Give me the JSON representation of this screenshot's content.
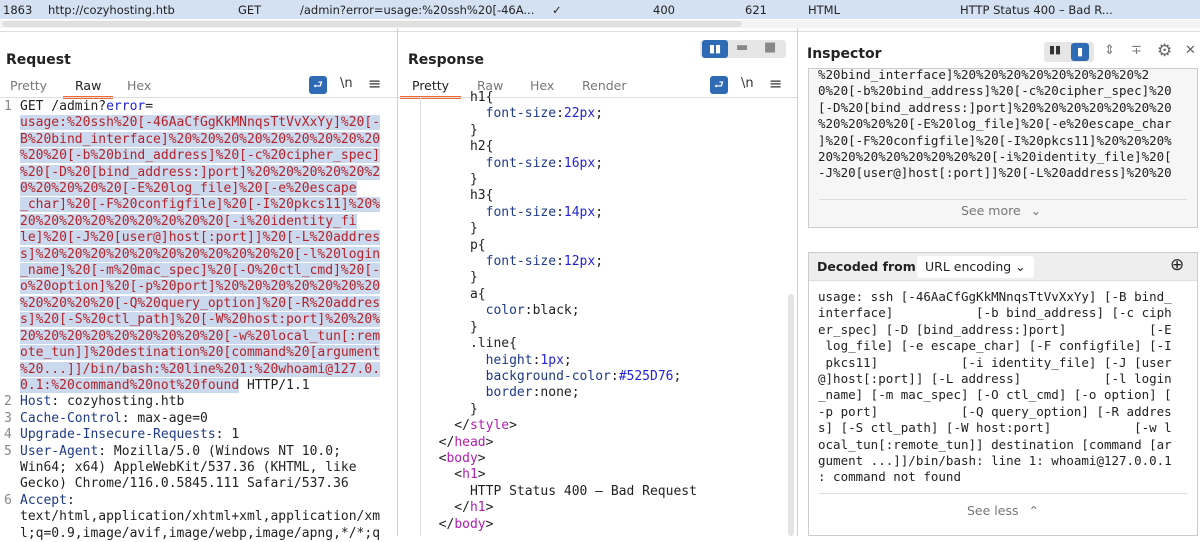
{
  "history_row": {
    "id": "1863",
    "host": "http://cozyhosting.htb",
    "method": "GET",
    "url": "/admin?error=usage:%20ssh%20[-46A...",
    "edited": "✓",
    "status": "400",
    "length": "621",
    "mime": "HTML",
    "title": "HTTP Status 400 – Bad R..."
  },
  "request": {
    "title": "Request",
    "tabs": [
      "Pretty",
      "Raw",
      "Hex"
    ],
    "active_tab": "Raw",
    "lines": [
      {
        "n": "1",
        "s": [
          {
            "t": "GET /admin?"
          },
          {
            "t": "error",
            "c": "bl"
          },
          {
            "t": "="
          }
        ]
      },
      {
        "n": "",
        "s": [
          {
            "t": "usage:%20ssh%20[-46AaCfGgKkMNnqsTtVvXxYy]%20[-",
            "c": "hl"
          }
        ]
      },
      {
        "n": "",
        "s": [
          {
            "t": "B%20bind_interface]%20%20%20%20%20%20%20%20%20",
            "c": "hl"
          }
        ]
      },
      {
        "n": "",
        "s": [
          {
            "t": "%20%20[-b%20bind_address]%20[-c%20cipher_spec]",
            "c": "hl"
          }
        ]
      },
      {
        "n": "",
        "s": [
          {
            "t": "%20[-D%20[bind_address:]port]%20%20%20%20%20%2",
            "c": "hl"
          }
        ]
      },
      {
        "n": "",
        "s": [
          {
            "t": "0%20%20%20%20[-E%20log_file]%20[-e%20escape",
            "c": "hl"
          }
        ]
      },
      {
        "n": "",
        "s": [
          {
            "t": "_char]%20[-F%20configfile]%20[-I%20pkcs11]%20%",
            "c": "hl"
          }
        ]
      },
      {
        "n": "",
        "s": [
          {
            "t": "20%20%20%20%20%20%20%20%20[-i%20identity_fi",
            "c": "hl"
          }
        ]
      },
      {
        "n": "",
        "s": [
          {
            "t": "le]%20[-J%20[user@]host[:port]]%20[-L%20addres",
            "c": "hl"
          }
        ]
      },
      {
        "n": "",
        "s": [
          {
            "t": "s]%20%20%20%20%20%20%20%20%20%20%20[-l%20login",
            "c": "hl"
          }
        ]
      },
      {
        "n": "",
        "s": [
          {
            "t": "_name]%20[-m%20mac_spec]%20[-O%20ctl_cmd]%20[-",
            "c": "hl"
          }
        ]
      },
      {
        "n": "",
        "s": [
          {
            "t": "o%20option]%20[-p%20port]%20%20%20%20%20%20%20",
            "c": "hl"
          }
        ]
      },
      {
        "n": "",
        "s": [
          {
            "t": "%20%20%20%20[-Q%20query_option]%20[-R%20addres",
            "c": "hl"
          }
        ]
      },
      {
        "n": "",
        "s": [
          {
            "t": "s]%20[-S%20ctl_path]%20[-W%20host:port]%20%20%",
            "c": "hl"
          }
        ]
      },
      {
        "n": "",
        "s": [
          {
            "t": "20%20%20%20%20%20%20%20%20[-w%20local_tun[:rem",
            "c": "hl"
          }
        ]
      },
      {
        "n": "",
        "s": [
          {
            "t": "ote_tun]]%20destination%20[command%20[argument",
            "c": "hl"
          }
        ]
      },
      {
        "n": "",
        "s": [
          {
            "t": "%20...]]/bin/bash:%20line%201:%20whoami@127.0.",
            "c": "hl"
          }
        ]
      },
      {
        "n": "",
        "s": [
          {
            "t": "0.1:%20command%20not%20found",
            "c": "hl"
          },
          {
            "t": " HTTP/1.1"
          }
        ]
      },
      {
        "n": "2",
        "s": [
          {
            "t": "Host",
            "c": "hn"
          },
          {
            "t": ": cozyhosting.htb"
          }
        ]
      },
      {
        "n": "3",
        "s": [
          {
            "t": "Cache-Control",
            "c": "hn"
          },
          {
            "t": ": max-age=0"
          }
        ]
      },
      {
        "n": "4",
        "s": [
          {
            "t": "Upgrade-Insecure-Requests",
            "c": "hn"
          },
          {
            "t": ": 1"
          }
        ]
      },
      {
        "n": "5",
        "s": [
          {
            "t": "User-Agent",
            "c": "hn"
          },
          {
            "t": ": Mozilla/5.0 (Windows NT 10.0;"
          }
        ]
      },
      {
        "n": "",
        "s": [
          {
            "t": "Win64; x64) AppleWebKit/537.36 (KHTML, like"
          }
        ]
      },
      {
        "n": "",
        "s": [
          {
            "t": "Gecko) Chrome/116.0.5845.111 Safari/537.36"
          }
        ]
      },
      {
        "n": "6",
        "s": [
          {
            "t": "Accept",
            "c": "hn"
          },
          {
            "t": ":"
          }
        ]
      },
      {
        "n": "",
        "s": [
          {
            "t": "text/html,application/xhtml+xml,application/xm"
          }
        ]
      },
      {
        "n": "",
        "s": [
          {
            "t": "l;q=0.9,image/avif,image/webp,image/apng,*/*;q"
          }
        ]
      }
    ]
  },
  "response": {
    "title": "Response",
    "tabs": [
      "Pretty",
      "Raw",
      "Hex",
      "Render"
    ],
    "active_tab": "Pretty",
    "lines": [
      {
        "s": [
          {
            "t": "      h1{"
          }
        ]
      },
      {
        "s": [
          {
            "t": "        "
          },
          {
            "t": "font-size",
            "c": "hn"
          },
          {
            "t": ":"
          },
          {
            "t": "22px",
            "c": "bl"
          },
          {
            "t": ";"
          }
        ]
      },
      {
        "s": [
          {
            "t": "      }"
          }
        ]
      },
      {
        "s": [
          {
            "t": "      h2{"
          }
        ]
      },
      {
        "s": [
          {
            "t": "        "
          },
          {
            "t": "font-size",
            "c": "hn"
          },
          {
            "t": ":"
          },
          {
            "t": "16px",
            "c": "bl"
          },
          {
            "t": ";"
          }
        ]
      },
      {
        "s": [
          {
            "t": "      }"
          }
        ]
      },
      {
        "s": [
          {
            "t": "      h3{"
          }
        ]
      },
      {
        "s": [
          {
            "t": "        "
          },
          {
            "t": "font-size",
            "c": "hn"
          },
          {
            "t": ":"
          },
          {
            "t": "14px",
            "c": "bl"
          },
          {
            "t": ";"
          }
        ]
      },
      {
        "s": [
          {
            "t": "      }"
          }
        ]
      },
      {
        "s": [
          {
            "t": "      p{"
          }
        ]
      },
      {
        "s": [
          {
            "t": "        "
          },
          {
            "t": "font-size",
            "c": "hn"
          },
          {
            "t": ":"
          },
          {
            "t": "12px",
            "c": "bl"
          },
          {
            "t": ";"
          }
        ]
      },
      {
        "s": [
          {
            "t": "      }"
          }
        ]
      },
      {
        "s": [
          {
            "t": "      a{"
          }
        ]
      },
      {
        "s": [
          {
            "t": "        "
          },
          {
            "t": "color",
            "c": "hn"
          },
          {
            "t": ":black;"
          }
        ]
      },
      {
        "s": [
          {
            "t": "      }"
          }
        ]
      },
      {
        "s": [
          {
            "t": "      .line{"
          }
        ]
      },
      {
        "s": [
          {
            "t": "        "
          },
          {
            "t": "height",
            "c": "hn"
          },
          {
            "t": ":"
          },
          {
            "t": "1px",
            "c": "bl"
          },
          {
            "t": ";"
          }
        ]
      },
      {
        "s": [
          {
            "t": "        "
          },
          {
            "t": "background-color",
            "c": "hn"
          },
          {
            "t": ":"
          },
          {
            "t": "#525D76",
            "c": "bl"
          },
          {
            "t": ";"
          }
        ]
      },
      {
        "s": [
          {
            "t": "        "
          },
          {
            "t": "border",
            "c": "hn"
          },
          {
            "t": ":none;"
          }
        ]
      },
      {
        "s": [
          {
            "t": "      }"
          }
        ]
      },
      {
        "s": [
          {
            "t": "    </"
          },
          {
            "t": "style",
            "c": "tg"
          },
          {
            "t": ">"
          }
        ]
      },
      {
        "s": [
          {
            "t": "  </"
          },
          {
            "t": "head",
            "c": "tg"
          },
          {
            "t": ">"
          }
        ]
      },
      {
        "s": [
          {
            "t": "  <"
          },
          {
            "t": "body",
            "c": "tg"
          },
          {
            "t": ">"
          }
        ]
      },
      {
        "s": [
          {
            "t": "    <"
          },
          {
            "t": "h1",
            "c": "tg"
          },
          {
            "t": ">"
          }
        ]
      },
      {
        "s": [
          {
            "t": "      HTTP Status 400 – Bad Request"
          }
        ]
      },
      {
        "s": [
          {
            "t": "    </"
          },
          {
            "t": "h1",
            "c": "tg"
          },
          {
            "t": ">"
          }
        ]
      },
      {
        "s": [
          {
            "t": "  </"
          },
          {
            "t": "body",
            "c": "tg"
          },
          {
            "t": ">"
          }
        ]
      }
    ]
  },
  "inspector": {
    "title": "Inspector",
    "selected_text": "%20bind_interface]%20%20%20%20%20%20%20%20%2\n0%20[-b%20bind_address]%20[-c%20cipher_spec]%20\n[-D%20[bind_address:]port]%20%20%20%20%20%20%20\n%20%20%20%20[-E%20log_file]%20[-e%20escape_char\n]%20[-F%20configfile]%20[-I%20pkcs11]%20%20%20%\n20%20%20%20%20%20%20%20[-i%20identity_file]%20[\n-J%20[user@]host[:port]]%20[-L%20address]%20%20",
    "see_more": "See more",
    "decoded_label": "Decoded from:",
    "decoded_type": "URL encoding",
    "decoded_text": "usage: ssh [-46AaCfGgKkMNnqsTtVvXxYy] [-B bind_\ninterface]           [-b bind_address] [-c ciph\ner_spec] [-D [bind_address:]port]           [-E\n log_file] [-e escape_char] [-F configfile] [-I\n pkcs11]           [-i identity_file] [-J [user\n@]host[:port]] [-L address]           [-l login\n_name] [-m mac_spec] [-O ctl_cmd] [-o option] [\n-p port]           [-Q query_option] [-R addres\ns] [-S ctl_path] [-W host:port]           [-w l\nocal_tun[:remote_tun]] destination [command [ar\ngument ...]]/bin/bash: line 1: whoami@127.0.0.1\n: command not found",
    "see_less": "See less"
  },
  "icons": {
    "wrap": "⮐",
    "newline": "\\n",
    "menu": "≡",
    "chev_down": "⌄",
    "chev_up": "⌃",
    "gear": "⚙",
    "close": "✕",
    "plus": "⊕"
  },
  "colors": {
    "accent": "#f06a35",
    "selection": "#cbd9ee",
    "button_blue": "#2f6ab5"
  }
}
